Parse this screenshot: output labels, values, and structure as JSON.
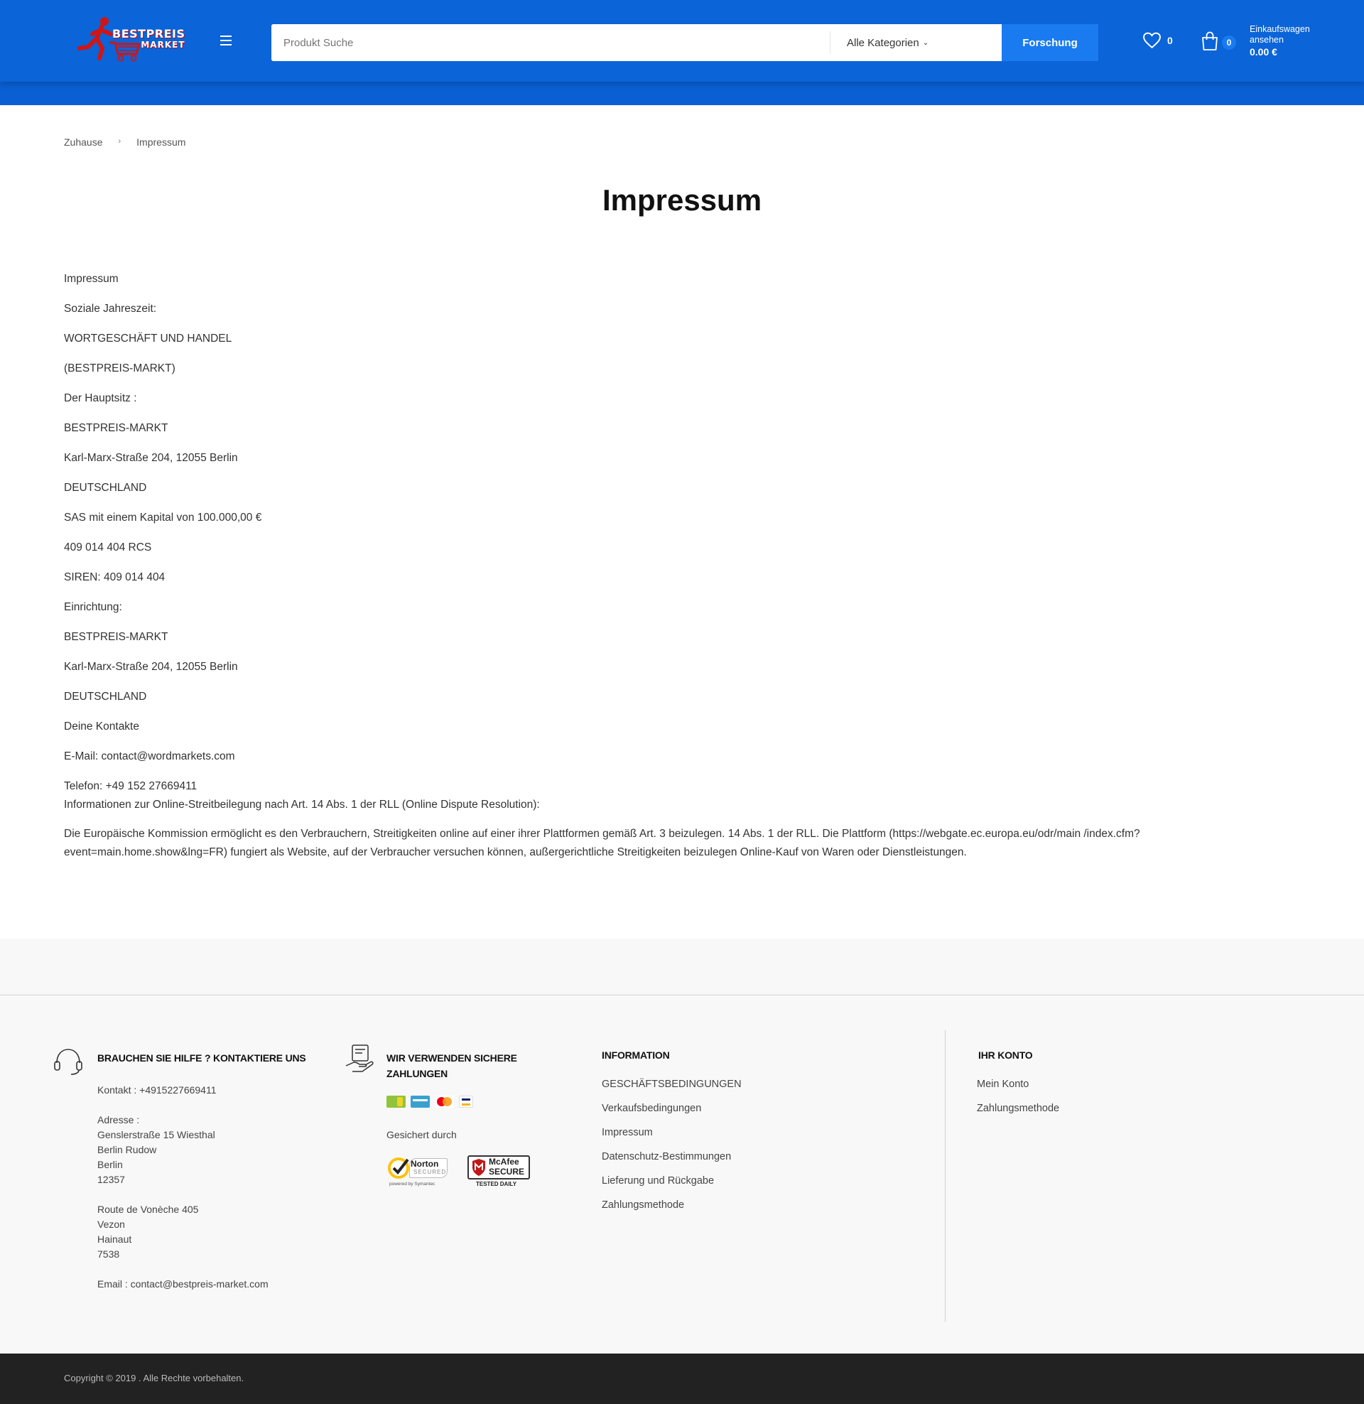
{
  "header": {
    "logo_line1": "BESTPREIS",
    "logo_line2": "MARKET",
    "search_placeholder": "Produkt Suche",
    "category": "Alle Kategorien",
    "search_button": "Forschung",
    "wishlist_count": "0",
    "cart_count": "0",
    "cart_label": "Einkaufswagen ansehen",
    "cart_total": "0.00 €"
  },
  "breadcrumb": {
    "home": "Zuhause",
    "separator": "›",
    "current": "Impressum"
  },
  "page": {
    "title": "Impressum",
    "lines": [
      "Impressum",
      "Soziale Jahreszeit:",
      "WORTGESCHÄFT UND HANDEL",
      "(BESTPREIS-MARKT)",
      "Der Hauptsitz :",
      "BESTPREIS-MARKT",
      "Karl-Marx-Straße 204, 12055 Berlin",
      "DEUTSCHLAND",
      "SAS mit einem Kapital von 100.000,00 €",
      "409 014 404 RCS",
      "SIREN: 409 014 404",
      "Einrichtung:",
      "BESTPREIS-MARKT",
      "Karl-Marx-Straße 204, 12055 Berlin",
      "DEUTSCHLAND",
      "Deine Kontakte",
      "E-Mail: contact@wordmarkets.com"
    ],
    "phone": "Telefon: +49 152 27669411",
    "odr_info": "Informationen zur Online-Streitbeilegung nach Art. 14 Abs. 1 der RLL (Online Dispute Resolution):",
    "odr_text": "Die Europäische Kommission ermöglicht es den Verbrauchern, Streitigkeiten online auf einer ihrer Plattformen gemäß Art. 3 beizulegen. 14 Abs. 1 der RLL. Die Plattform (https://webgate.ec.europa.eu/odr/main /index.cfm?event=main.home.show&lng=FR) fungiert als Website, auf der Verbraucher versuchen können, außergerichtliche Streitigkeiten beizulegen Online-Kauf von Waren oder Dienstleistungen."
  },
  "footer": {
    "help": {
      "title": "BRAUCHEN SIE HILFE ? KONTAKTIERE UNS",
      "contact": "Kontakt : +4915227669411",
      "address_label": "Adresse :",
      "address1": [
        "Genslerstraße 15 Wiesthal",
        "Berlin Rudow",
        "Berlin",
        "12357"
      ],
      "address2": [
        "Route de Vonèche 405",
        "Vezon",
        "Hainaut",
        "7538"
      ],
      "email": "Email : contact@bestpreis-market.com"
    },
    "payments": {
      "title_line1": "WIR VERWENDEN SICHERE",
      "title_line2": "ZAHLUNGEN",
      "secured_by": "Gesichert durch",
      "norton_label": "Norton",
      "norton_sub": "SECURED",
      "norton_powered": "powered by Symantec",
      "mcafee_label": "McAfee",
      "mcafee_sub": "SECURE",
      "mcafee_tested": "TESTED DAILY"
    },
    "information": {
      "title": "INFORMATION",
      "links": [
        "GESCHÄFTSBEDINGUNGEN",
        "Verkaufsbedingungen",
        "Impressum",
        "Datenschutz-Bestimmungen",
        "Lieferung und Rückgabe",
        "Zahlungsmethode"
      ]
    },
    "account": {
      "title": "IHR KONTO",
      "links": [
        "Mein Konto",
        "Zahlungsmethode"
      ]
    },
    "copyright": "Copyright © 2019 . Alle Rechte vorbehalten."
  },
  "colors": {
    "header_blue": "#0b64d8",
    "button_blue": "#1a7bf0",
    "logo_red": "#d01515",
    "footer_bg": "#f8f8f8",
    "copyright_bg": "#222222"
  }
}
